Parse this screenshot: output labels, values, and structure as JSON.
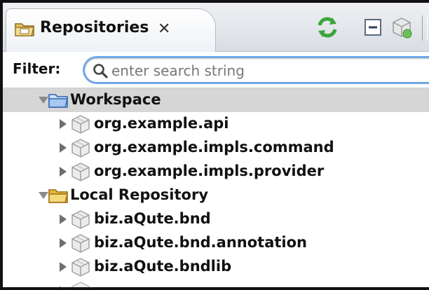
{
  "view": {
    "title": "Repositories",
    "close_glyph": "✕"
  },
  "toolbar": {
    "buttons": [
      "refresh-icon",
      "collapse-all-icon",
      "add-bundle-icon"
    ]
  },
  "filter": {
    "label": "Filter:",
    "placeholder": "enter search string",
    "value": ""
  },
  "tree": {
    "workspace": {
      "label": "Workspace",
      "expanded": true,
      "children": [
        "org.example.api",
        "org.example.impls.command",
        "org.example.impls.provider"
      ]
    },
    "local_repository": {
      "label": "Local Repository",
      "expanded": true,
      "children": [
        "biz.aQute.bnd",
        "biz.aQute.bnd.annotation",
        "biz.aQute.bndlib"
      ]
    }
  },
  "colors": {
    "folder": "#f3c85a",
    "workspace_folder": "#8fb8ea",
    "selection": "#d6d6d6",
    "focus_ring": "#6fa7e6",
    "refresh_green": "#3aa53a"
  }
}
